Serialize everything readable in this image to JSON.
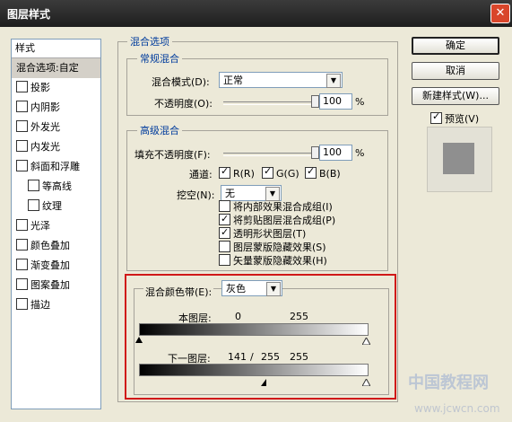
{
  "window": {
    "title": "图层样式",
    "close_glyph": "✕"
  },
  "styles": {
    "header": "样式",
    "items": [
      {
        "label": "混合选项:自定",
        "checkbox": false,
        "selected": true,
        "indent": false
      },
      {
        "label": "投影",
        "checkbox": true,
        "checked": false,
        "indent": false
      },
      {
        "label": "内阴影",
        "checkbox": true,
        "checked": false,
        "indent": false
      },
      {
        "label": "外发光",
        "checkbox": true,
        "checked": false,
        "indent": false
      },
      {
        "label": "内发光",
        "checkbox": true,
        "checked": false,
        "indent": false
      },
      {
        "label": "斜面和浮雕",
        "checkbox": true,
        "checked": false,
        "indent": false
      },
      {
        "label": "等高线",
        "checkbox": true,
        "checked": false,
        "indent": true
      },
      {
        "label": "纹理",
        "checkbox": true,
        "checked": false,
        "indent": true
      },
      {
        "label": "光泽",
        "checkbox": true,
        "checked": false,
        "indent": false
      },
      {
        "label": "颜色叠加",
        "checkbox": true,
        "checked": false,
        "indent": false
      },
      {
        "label": "渐变叠加",
        "checkbox": true,
        "checked": false,
        "indent": false
      },
      {
        "label": "图案叠加",
        "checkbox": true,
        "checked": false,
        "indent": false
      },
      {
        "label": "描边",
        "checkbox": true,
        "checked": false,
        "indent": false
      }
    ]
  },
  "blend_options": {
    "legend": "混合选项",
    "general": {
      "legend": "常规混合",
      "mode_label": "混合模式(D):",
      "mode_value": "正常",
      "opacity_label": "不透明度(O):",
      "opacity_value": "100",
      "opacity_unit": "%",
      "opacity_level": 1.0
    },
    "advanced": {
      "legend": "高级混合",
      "fill_label": "填充不透明度(F):",
      "fill_value": "100",
      "fill_unit": "%",
      "fill_level": 1.0,
      "channels_label": "通道:",
      "channel_r": "R(R)",
      "channel_g": "G(G)",
      "channel_b": "B(B)",
      "knockout_label": "挖空(N):",
      "knockout_value": "无",
      "options": [
        {
          "label": "将内部效果混合成组(I)",
          "checked": false
        },
        {
          "label": "将剪贴图层混合成组(P)",
          "checked": true
        },
        {
          "label": "透明形状图层(T)",
          "checked": true
        },
        {
          "label": "图层蒙版隐藏效果(S)",
          "checked": false
        },
        {
          "label": "矢量蒙版隐藏效果(H)",
          "checked": false
        }
      ]
    },
    "blend_if": {
      "label": "混合颜色带(E):",
      "value": "灰色",
      "this_layer_label": "本图层:",
      "this_layer_low": "0",
      "this_layer_high": "255",
      "underlying_label": "下一图层:",
      "underlying_low_a": "141",
      "underlying_sep": "/",
      "underlying_low_b": "255",
      "underlying_high": "255",
      "underlying_split_value": 141
    }
  },
  "buttons": {
    "ok": "确定",
    "cancel": "取消",
    "new_style": "新建样式(W)...",
    "preview_label": "预览(V)"
  },
  "watermark": {
    "text": "中国教程网",
    "url": "www.jcwcn.com"
  },
  "colors": {
    "highlight": "#d01818",
    "title_bar": "#1e1e1e",
    "legend_text": "#003c9d"
  }
}
